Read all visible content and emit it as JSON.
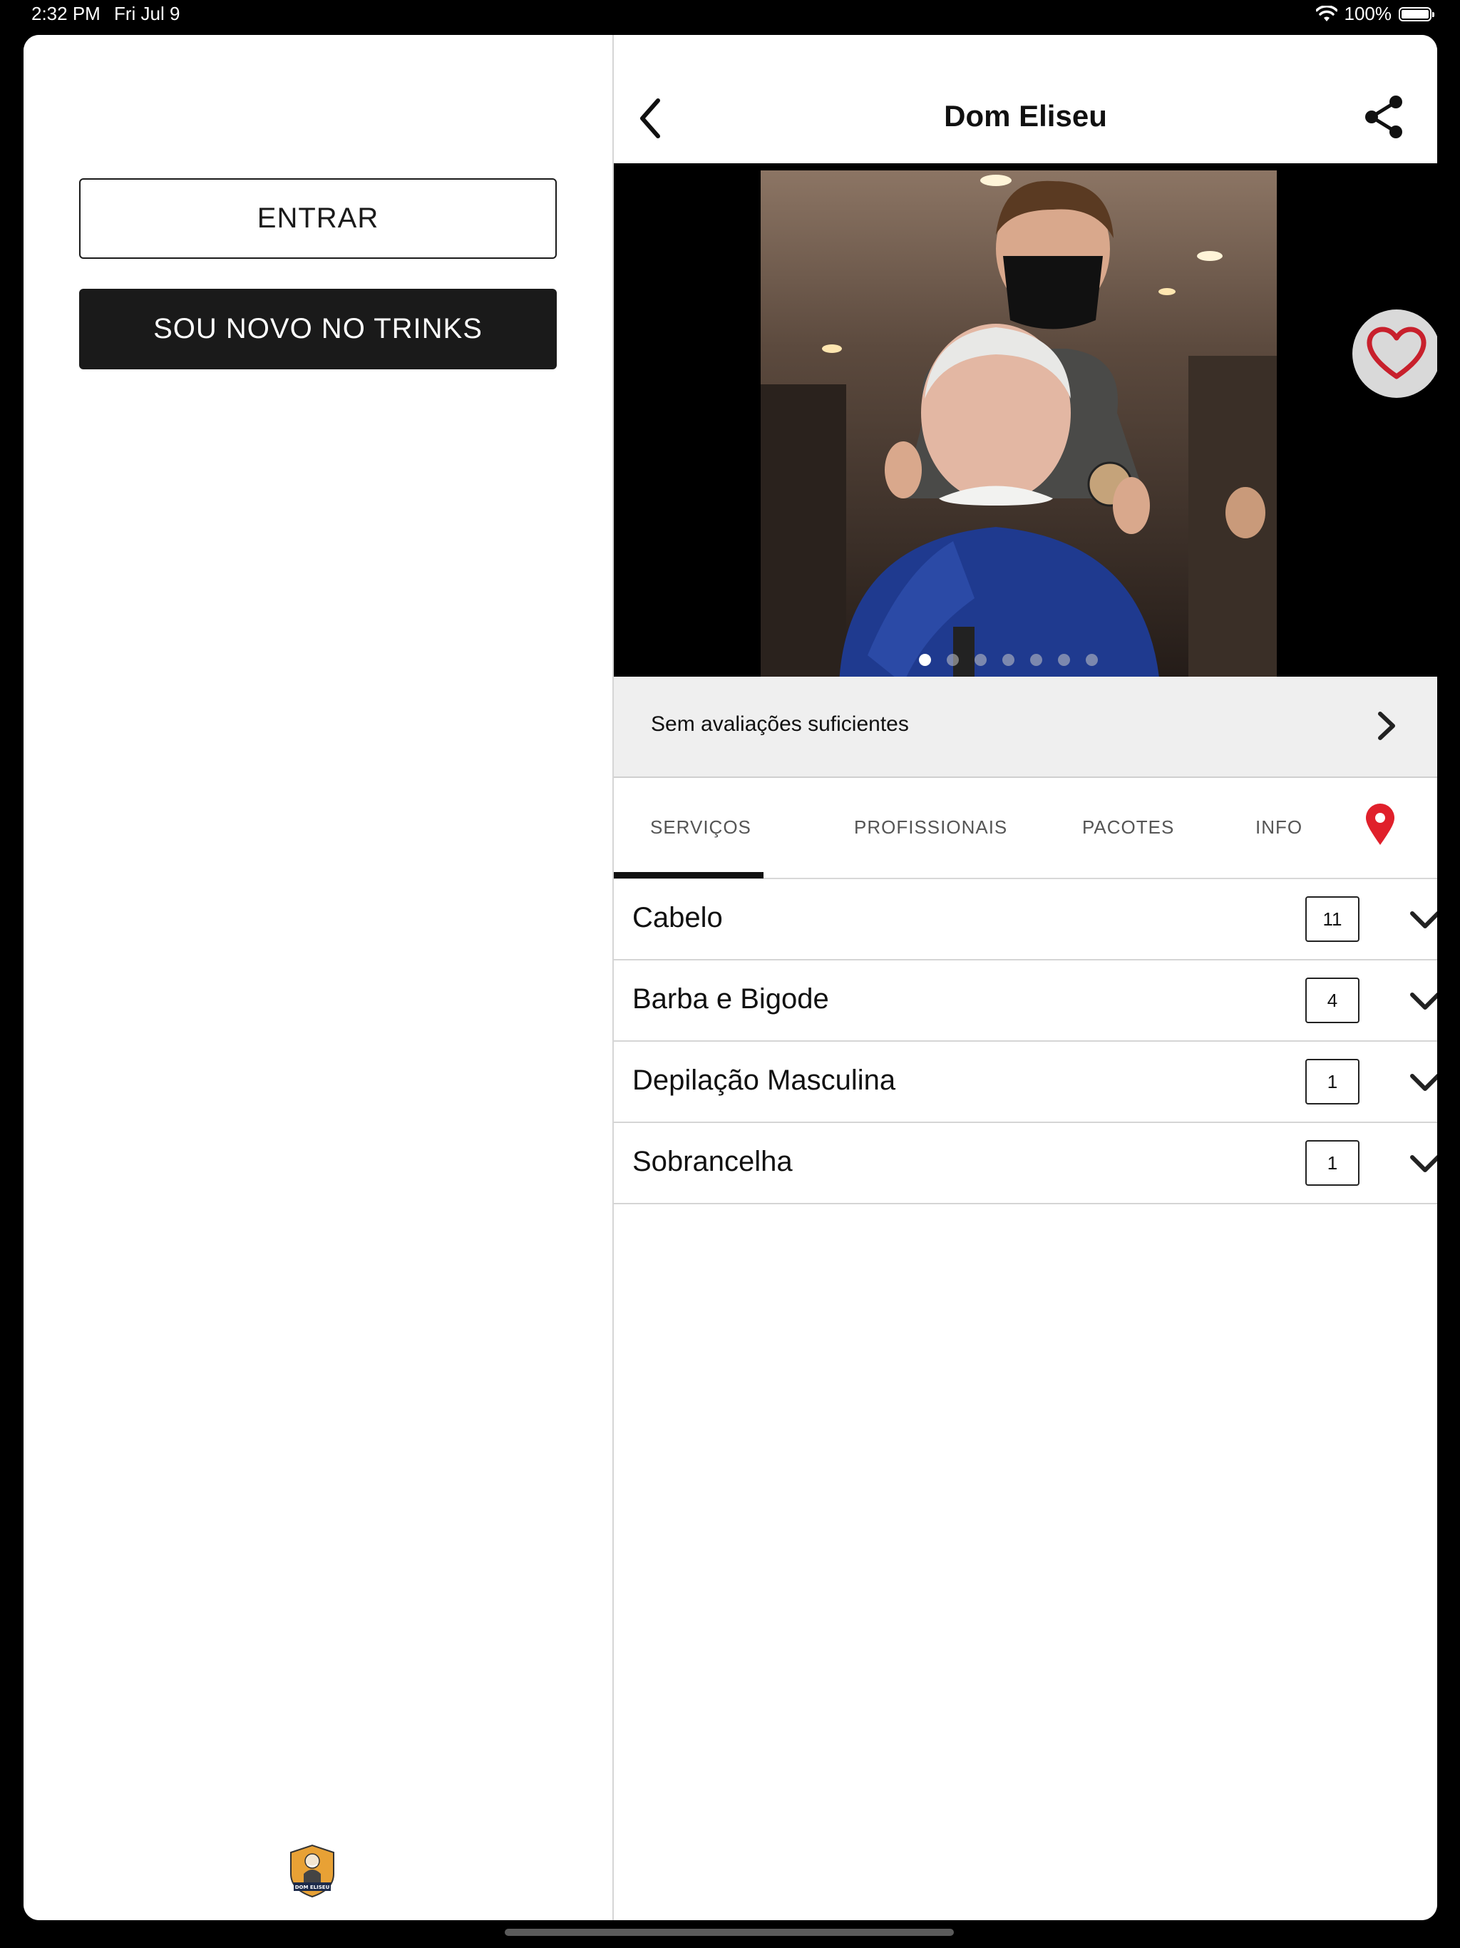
{
  "status_bar": {
    "time": "2:32 PM",
    "date": "Fri Jul 9",
    "battery": "100%"
  },
  "auth": {
    "login_label": "ENTRAR",
    "signup_label": "SOU NOVO NO TRINKS"
  },
  "logo": {
    "text": "DOM ELISEU"
  },
  "header": {
    "title": "Dom Eliseu"
  },
  "gallery": {
    "photo_count": 7,
    "active_index": 0
  },
  "reviews": {
    "label": "Sem avaliações suficientes"
  },
  "tabs": [
    {
      "label": "SERVIÇOS",
      "active": true
    },
    {
      "label": "PROFISSIONAIS",
      "active": false
    },
    {
      "label": "PACOTES",
      "active": false
    },
    {
      "label": "INFO",
      "active": false
    }
  ],
  "categories": [
    {
      "name": "Cabelo",
      "count": "11"
    },
    {
      "name": "Barba e Bigode",
      "count": "4"
    },
    {
      "name": "Depilação Masculina",
      "count": "1"
    },
    {
      "name": "Sobrancelha",
      "count": "1"
    }
  ],
  "colors": {
    "accent_red": "#e0202b",
    "primary_dark": "#1a1a1a"
  }
}
